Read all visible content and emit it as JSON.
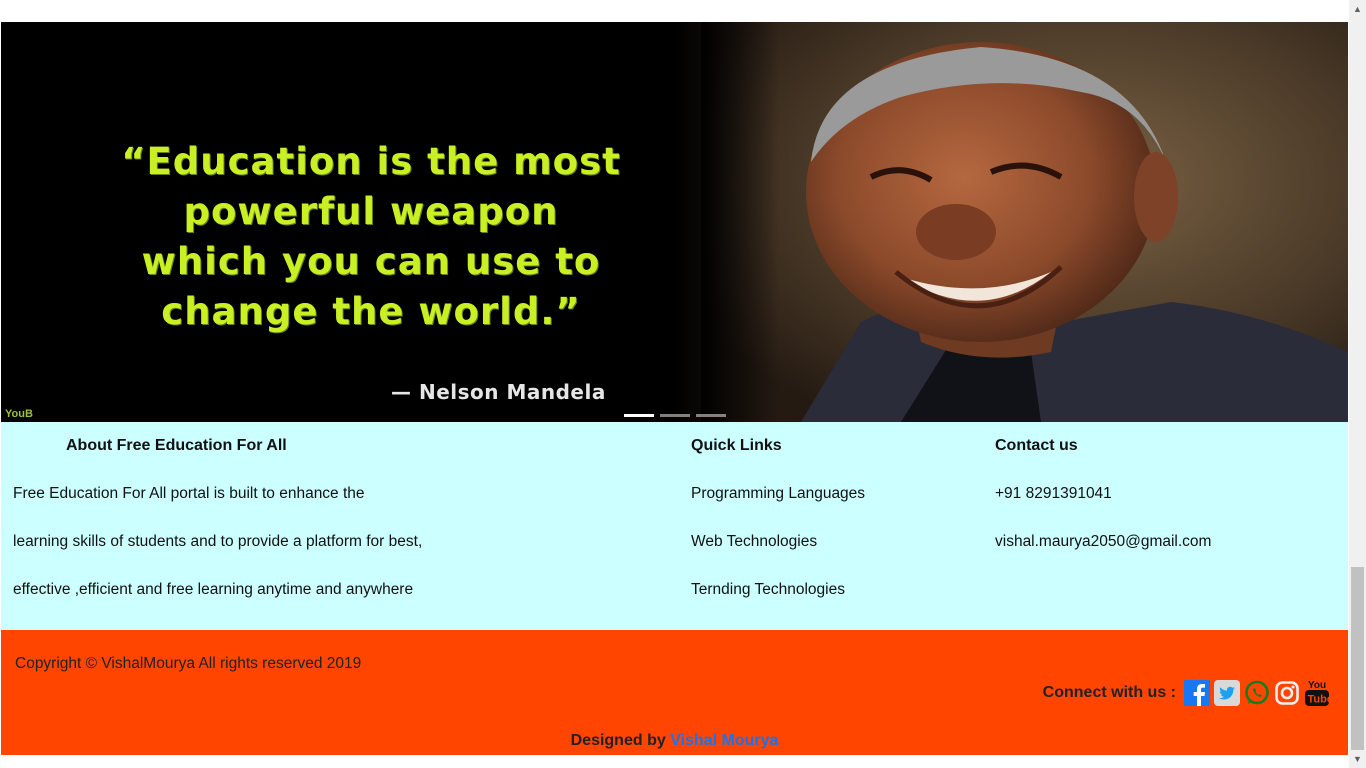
{
  "carousel": {
    "quote_lines": [
      "“Education is the most",
      "powerful weapon",
      "which you can use to",
      "change the world.”"
    ],
    "author": "— Nelson Mandela",
    "watermark": "YouB",
    "slides": 3,
    "active_slide": 1
  },
  "about": {
    "heading": "About Free Education For All",
    "lines": [
      "Free Education For All portal is built to enhance the",
      "learning skills of students and to provide a platform for best,",
      "effective ,efficient and free learning anytime and anywhere"
    ]
  },
  "quick_links": {
    "heading": "Quick Links",
    "items": [
      "Programming Languages",
      "Web Technologies",
      "Ternding Technologies"
    ]
  },
  "contact": {
    "heading": "Contact us",
    "phone": "+91 8291391041",
    "email": "vishal.maurya2050@gmail.com"
  },
  "footer": {
    "copyright": "Copyright © VishalMourya All rights reserved 2019",
    "connect_label": "Connect with us :",
    "social_icons": [
      "facebook-icon",
      "twitter-icon",
      "whatsapp-icon",
      "instagram-icon",
      "youtube-icon"
    ],
    "designed_prefix": "Designed by",
    "designer": "Vishal Mourya"
  },
  "colors": {
    "info_bg": "#ccffff",
    "footer_bg": "#ff4500",
    "quote": "#c9f024",
    "designer_link": "#1a73e8"
  }
}
